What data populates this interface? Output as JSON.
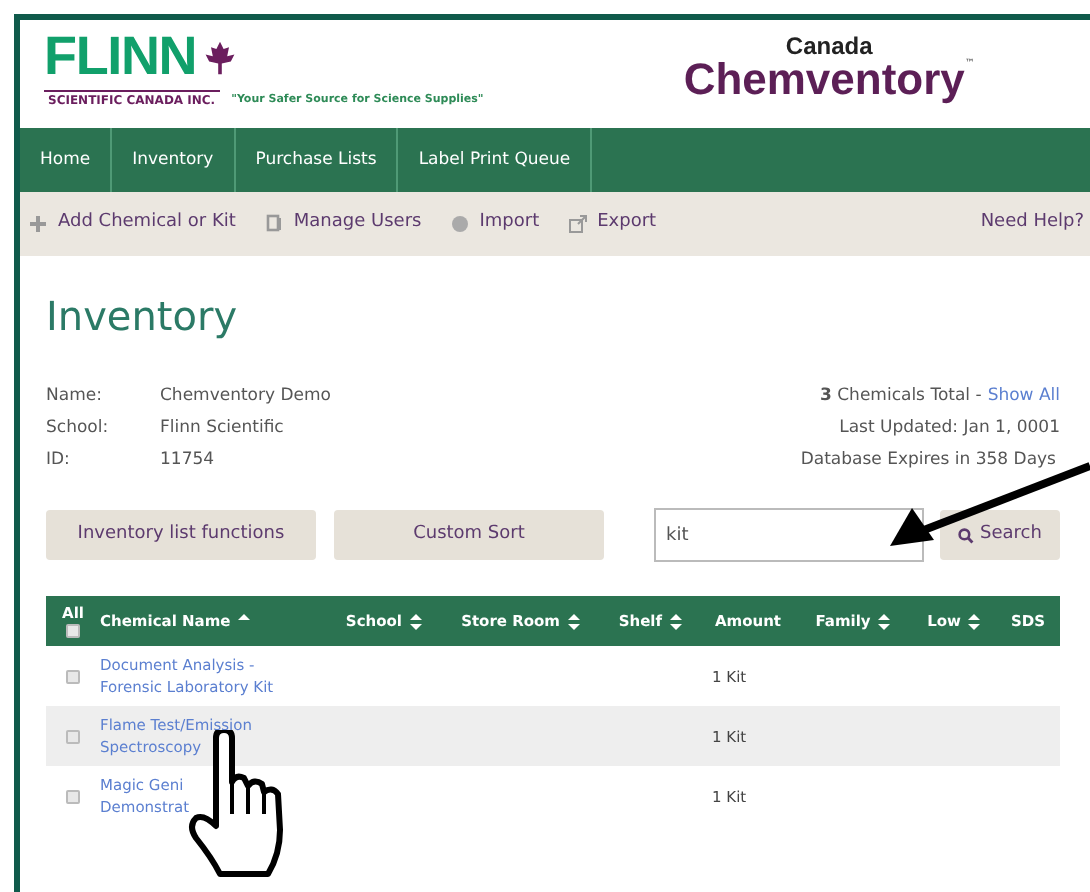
{
  "header": {
    "brand": "FLINN",
    "brand_sub": "SCIENTIFIC CANADA INC.",
    "tagline": "\"Your Safer Source for Science Supplies\"",
    "product_top": "Canada",
    "product": "Chemventory",
    "trademark": "™"
  },
  "nav": [
    {
      "label": "Home",
      "selected": false
    },
    {
      "label": "Inventory",
      "selected": false
    },
    {
      "label": "Purchase Lists",
      "selected": false
    },
    {
      "label": "Label Print Queue",
      "selected": false
    }
  ],
  "toolbar": [
    {
      "label": "Add Chemical or Kit",
      "kind": "add"
    },
    {
      "label": "Manage Users",
      "kind": "users"
    },
    {
      "label": "Import",
      "kind": "import"
    },
    {
      "label": "Export",
      "kind": "export"
    }
  ],
  "help": "Need Help?",
  "page_title": "Inventory",
  "info": [
    {
      "label": "Name:",
      "value": "Chemventory Demo"
    },
    {
      "label": "School:",
      "value": "Flinn Scientific"
    },
    {
      "label": "ID:",
      "value": "11754"
    }
  ],
  "summary": {
    "total": "**3** Chemicals Total -",
    "show_all": "Show All",
    "updated": "Last Updated: Jan 1, 0001",
    "expires": "Database Expires in 358 Days"
  },
  "buttons": [
    "Inventory list functions",
    "Custom Sort"
  ],
  "search": {
    "value": "kit",
    "button": "Search"
  },
  "table": {
    "select_all": {
      "label": "All",
      "checked": false
    },
    "columns": [
      {
        "label": "Chemical Name",
        "sort_up": true,
        "sort_down": false
      },
      {
        "label": "School",
        "sort_up": true,
        "sort_down": true
      },
      {
        "label": "Store Room",
        "sort_up": true,
        "sort_down": true
      },
      {
        "label": "Shelf",
        "sort_up": true,
        "sort_down": true
      },
      {
        "label": "Amount",
        "sort_up": false,
        "sort_down": false
      },
      {
        "label": "Family",
        "sort_up": true,
        "sort_down": true
      },
      {
        "label": "Low",
        "sort_up": true,
        "sort_down": true
      },
      {
        "label": "SDS",
        "sort_up": false,
        "sort_down": false
      }
    ],
    "rows": [
      {
        "name": "Document Analysis -\nForensic Laboratory Kit",
        "amount": "1 Kit",
        "checked": false,
        "selected": false
      },
      {
        "name": "Flame Test/Emission\nSpectroscopy",
        "amount": "1 Kit",
        "checked": false,
        "selected": true
      },
      {
        "name": "Magic Geni\nDemonstrat",
        "amount": "1 Kit",
        "checked": false,
        "selected": false
      }
    ]
  }
}
